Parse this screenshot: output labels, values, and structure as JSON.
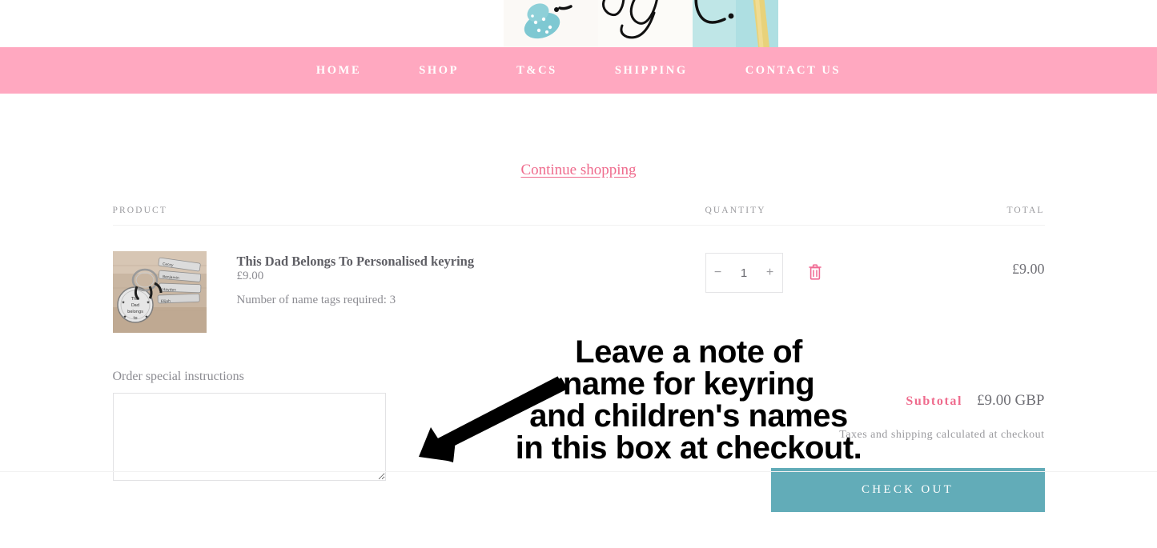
{
  "theme": {
    "nav_pink": "#ffa8c0",
    "link_pink": "#ef6b8d",
    "checkout_teal": "#62acb8",
    "text_grey": "#8c8c92"
  },
  "header": {
    "logo_alt": "watercolor script logo"
  },
  "nav": {
    "items": [
      {
        "label": "HOME"
      },
      {
        "label": "SHOP"
      },
      {
        "label": "T&CS"
      },
      {
        "label": "SHIPPING"
      },
      {
        "label": "CONTACT US"
      }
    ]
  },
  "cart": {
    "continue_shopping": "Continue shopping",
    "columns": {
      "product": "PRODUCT",
      "quantity": "QUANTITY",
      "total": "TOTAL"
    },
    "items": [
      {
        "title": "This Dad Belongs To Personalised keyring",
        "price": "£9.00",
        "property": "Number of name tags required: 3",
        "quantity": "1",
        "decrease_label": "−",
        "increase_label": "+",
        "remove_label": "Remove",
        "line_total": "£9.00"
      }
    ]
  },
  "notes": {
    "label": "Order special instructions",
    "value": "",
    "placeholder": ""
  },
  "summary": {
    "subtotal_label": "Subtotal",
    "subtotal_value": "£9.00 GBP",
    "tax_note": "Taxes and shipping calculated at checkout",
    "checkout_label": "CHECK OUT"
  },
  "annotation": {
    "line1": "Leave a note of",
    "line2": "name for keyring",
    "line3": "and children's names",
    "line4": "in this box at checkout."
  }
}
